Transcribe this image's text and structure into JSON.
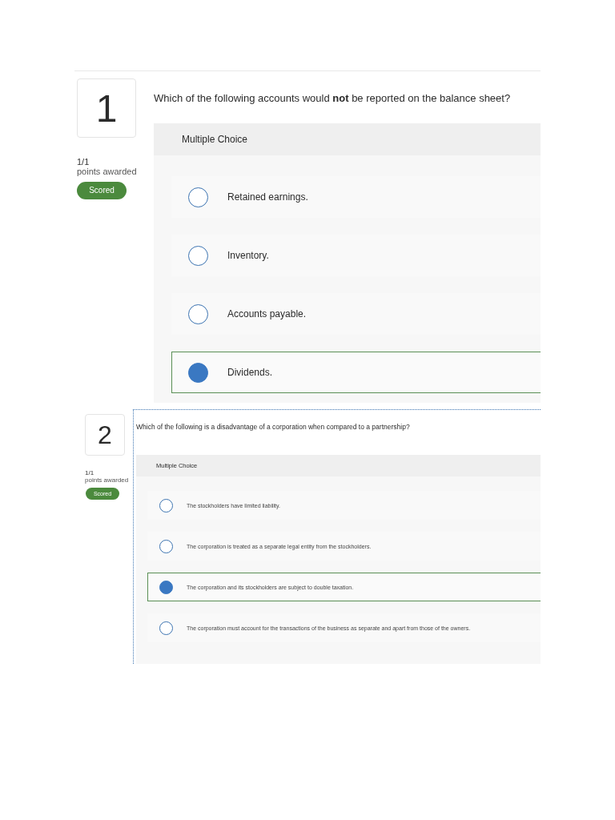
{
  "questions": [
    {
      "number": "1",
      "text": "Which of the following accounts would **not** be reported on the balance sheet?",
      "points": "1/1",
      "points_label": "points awarded",
      "status": "Scored",
      "type_label": "Multiple Choice",
      "options": [
        {
          "label": "Retained earnings.",
          "selected": false
        },
        {
          "label": "Inventory.",
          "selected": false
        },
        {
          "label": "Accounts payable.",
          "selected": false
        },
        {
          "label": "Dividends.",
          "selected": true
        }
      ]
    },
    {
      "number": "2",
      "text": "Which of the following is a disadvantage of a corporation when compared to a partnership?",
      "points": "1/1",
      "points_label": "points awarded",
      "status": "Scored",
      "type_label": "Multiple Choice",
      "options": [
        {
          "label": "The stockholders have limited liability.",
          "selected": false
        },
        {
          "label": "The corporation is treated as a separate legal entity from the stockholders.",
          "selected": false
        },
        {
          "label": "The corporation and its stockholders are subject to double taxation.",
          "selected": true
        },
        {
          "label": "The corporation must account for the transactions of the business as separate and apart from those of the owners.",
          "selected": false
        }
      ]
    }
  ]
}
